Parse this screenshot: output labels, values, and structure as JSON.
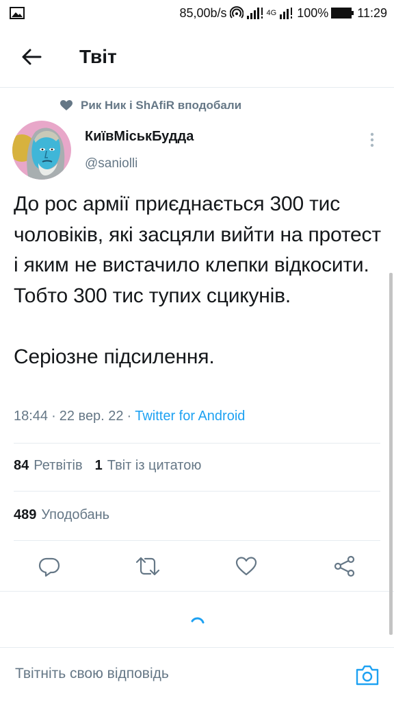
{
  "status_bar": {
    "speed": "85,00b/s",
    "network": "4G",
    "battery": "100%",
    "time": "11:29"
  },
  "header": {
    "title": "Твіт"
  },
  "tweet": {
    "social_context": "Рик Ник і ShAfiR вподобали",
    "display_name": "КиївМіськБудда",
    "handle": "@saniolli",
    "text": "До рос армії приєднається 300 тис чоловіків, які засцяли вийти на протест і яким не вистачило клепки відкосити. Тобто 300 тис тупих сцикунів.\n\nСеріозне підсилення.",
    "time": "18:44",
    "separator": "·",
    "date": "22 вер. 22",
    "source": "Twitter for Android",
    "retweets_count": "84",
    "retweets_label": "Ретвітів",
    "quotes_count": "1",
    "quotes_label": "Твіт із цитатою",
    "likes_count": "489",
    "likes_label": "Уподобань"
  },
  "reply": {
    "placeholder": "Твітніть свою відповідь"
  },
  "colors": {
    "accent": "#1da1f2",
    "secondary_text": "#657786",
    "divider": "#e6ecf0"
  }
}
